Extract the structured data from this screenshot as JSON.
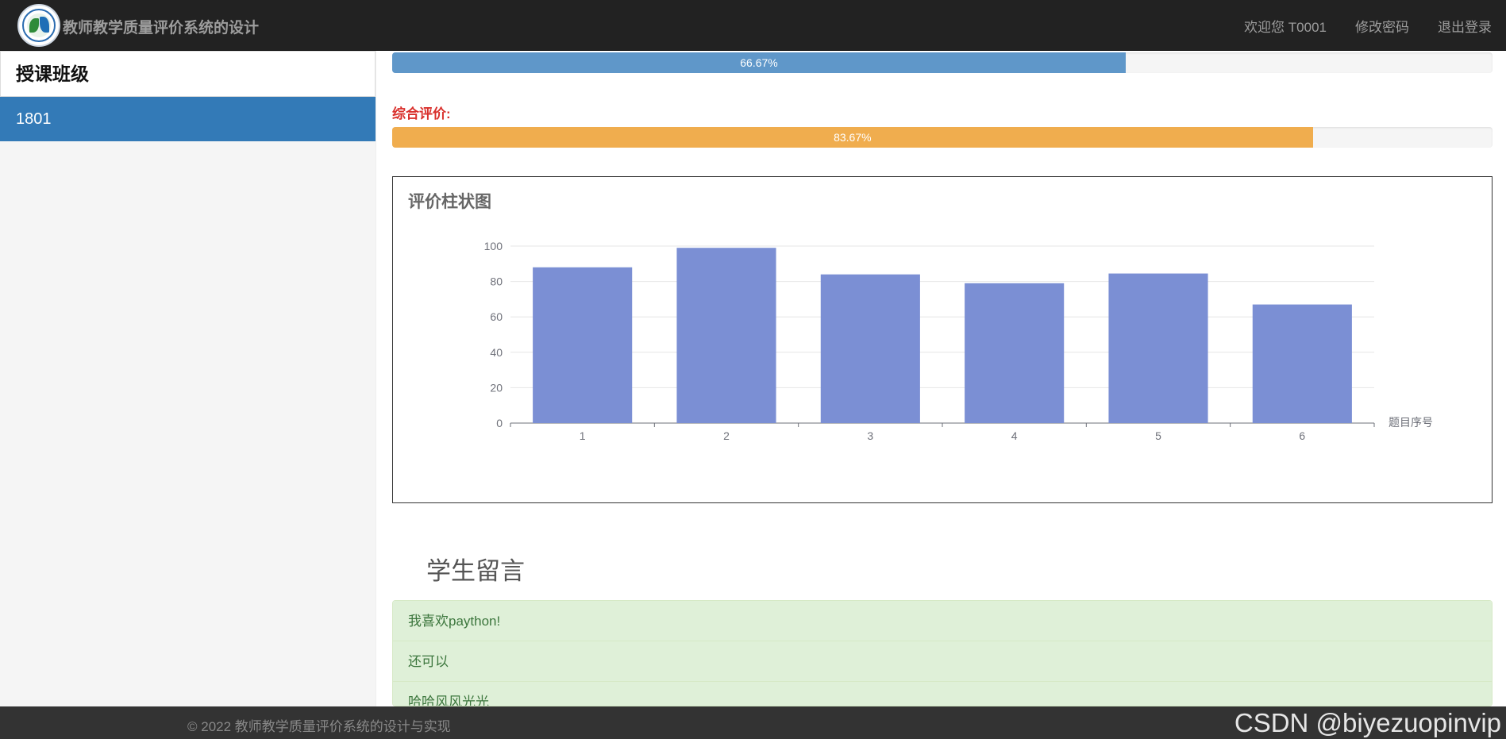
{
  "navbar": {
    "brand": "教师教学质量评价系统的设计",
    "links": [
      "欢迎您 T0001",
      "修改密码",
      "退出登录"
    ]
  },
  "sidebar": {
    "title": "授课班级",
    "items": [
      "1801"
    ]
  },
  "progress": {
    "first": {
      "value": 66.67,
      "label": "66.67%",
      "color": "#5f97c9"
    },
    "overall_label": "综合评价:",
    "overall": {
      "value": 83.67,
      "label": "83.67%",
      "color": "#f0ad4e"
    }
  },
  "chart_panel": {
    "title": "评价柱状图"
  },
  "chart_data": {
    "type": "bar",
    "categories": [
      "1",
      "2",
      "3",
      "4",
      "5",
      "6"
    ],
    "values": [
      88,
      99,
      84,
      79,
      84.5,
      67
    ],
    "xlabel": "题目序号",
    "ylabel": "",
    "ylim": [
      0,
      100
    ],
    "yticks": [
      "0",
      "20",
      "40",
      "60",
      "80",
      "100"
    ],
    "bar_color": "#7b8fd4",
    "grid": true
  },
  "messages": {
    "heading": "学生留言",
    "items": [
      "我喜欢paython!",
      "还可以",
      "哈哈风风光光"
    ]
  },
  "footer": {
    "text": "© 2022 教师教学质量评价系统的设计与实现",
    "watermark": "CSDN @biyezuopinvip"
  }
}
